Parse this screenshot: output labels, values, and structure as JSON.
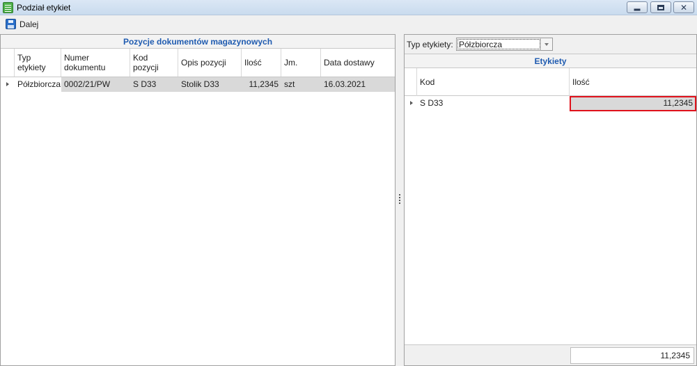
{
  "window": {
    "title": "Podział etykiet",
    "icon": "app-icon",
    "buttons": [
      "minimize-icon",
      "maximize-icon",
      "close-icon"
    ]
  },
  "toolbar": {
    "next_label": "Dalej",
    "next_icon": "save-icon"
  },
  "left_panel": {
    "caption": "Pozycje dokumentów magazynowych",
    "columns": [
      "Typ etykiety",
      "Numer dokumentu",
      "Kod pozycji",
      "Opis pozycji",
      "Ilość",
      "Jm.",
      "Data dostawy"
    ],
    "rows": [
      {
        "typ_etykiety": "Półzbiorcza",
        "numer_dokumentu": "0002/21/PW",
        "kod_pozycji": "S D33",
        "opis_pozycji": "Stolik D33",
        "ilosc": "11,2345",
        "jm": "szt",
        "data_dostawy": "16.03.2021"
      }
    ]
  },
  "right_panel": {
    "type_label": "Typ etykiety:",
    "type_value": "Półzbiorcza",
    "caption": "Etykiety",
    "columns": [
      "Kod",
      "Ilość"
    ],
    "rows": [
      {
        "kod": "S D33",
        "ilosc": "11,2345"
      }
    ],
    "total": "11,2345"
  },
  "colors": {
    "caption_blue": "#1f5bb0",
    "focus_border": "#e0111b",
    "selection": "#d9d9d9"
  }
}
